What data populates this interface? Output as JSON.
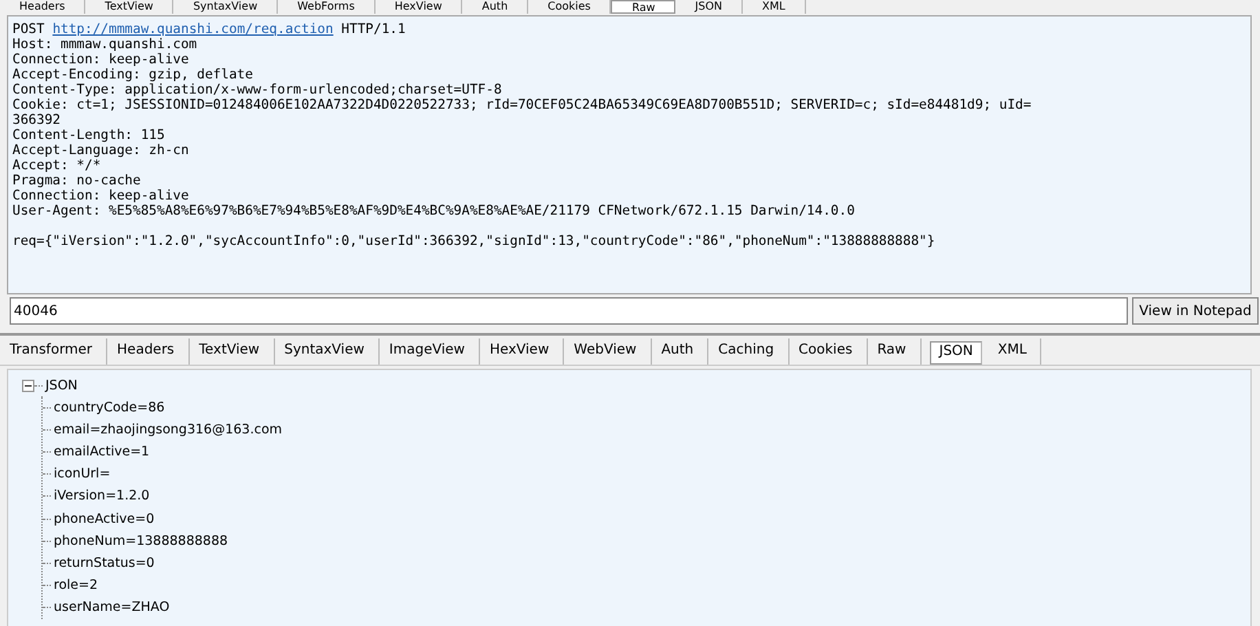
{
  "request_tabs": [
    {
      "label": "Headers",
      "selected": false
    },
    {
      "label": "TextView",
      "selected": false
    },
    {
      "label": "SyntaxView",
      "selected": false
    },
    {
      "label": "WebForms",
      "selected": false
    },
    {
      "label": "HexView",
      "selected": false
    },
    {
      "label": "Auth",
      "selected": false
    },
    {
      "label": "Cookies",
      "selected": false
    },
    {
      "label": "Raw",
      "selected": true
    },
    {
      "label": "JSON",
      "selected": false
    },
    {
      "label": "XML",
      "selected": false
    }
  ],
  "request": {
    "method": "POST",
    "url": "http://mmmaw.quanshi.com/req.action",
    "version": "HTTP/1.1",
    "lines": [
      "Host: mmmaw.quanshi.com",
      "Connection: keep-alive",
      "Accept-Encoding: gzip, deflate",
      "Content-Type: application/x-www-form-urlencoded;charset=UTF-8",
      "Cookie: ct=1; JSESSIONID=012484006E102AA7322D4D0220522733; rId=70CEF05C24BA65349C69EA8D700B551D; SERVERID=c; sId=e84481d9; uId=",
      "366392",
      "Content-Length: 115",
      "Accept-Language: zh-cn",
      "Accept: */*",
      "Pragma: no-cache",
      "Connection: keep-alive",
      "User-Agent: %E5%85%A8%E6%97%B6%E7%94%B5%E8%AF%9D%E4%BC%9A%E8%AE%AE/21179 CFNetwork/672.1.15 Darwin/14.0.0"
    ],
    "body": "req={\"iVersion\":\"1.2.0\",\"sycAccountInfo\":0,\"userId\":366392,\"signId\":13,\"countryCode\":\"86\",\"phoneNum\":\"13888888888\"}"
  },
  "find_field": {
    "value": "40046"
  },
  "notepad_button": "View in Notepad",
  "response_tabs": [
    {
      "label": "Transformer",
      "selected": false
    },
    {
      "label": "Headers",
      "selected": false
    },
    {
      "label": "TextView",
      "selected": false
    },
    {
      "label": "SyntaxView",
      "selected": false
    },
    {
      "label": "ImageView",
      "selected": false
    },
    {
      "label": "HexView",
      "selected": false
    },
    {
      "label": "WebView",
      "selected": false
    },
    {
      "label": "Auth",
      "selected": false
    },
    {
      "label": "Caching",
      "selected": false
    },
    {
      "label": "Cookies",
      "selected": false
    },
    {
      "label": "Raw",
      "selected": false
    },
    {
      "label": "JSON",
      "selected": true
    },
    {
      "label": "XML",
      "selected": false
    }
  ],
  "tree": {
    "label": "JSON",
    "expanded": true,
    "children": [
      {
        "label": "countryCode=86"
      },
      {
        "label": "email=zhaojingsong316@163.com"
      },
      {
        "label": "emailActive=1"
      },
      {
        "label": "iconUrl="
      },
      {
        "label": "iVersion=1.2.0"
      },
      {
        "label": "phoneActive=0"
      },
      {
        "label": "phoneNum=13888888888"
      },
      {
        "label": "returnStatus=0"
      },
      {
        "label": "role=2"
      },
      {
        "label": "userName=ZHAO"
      }
    ]
  }
}
